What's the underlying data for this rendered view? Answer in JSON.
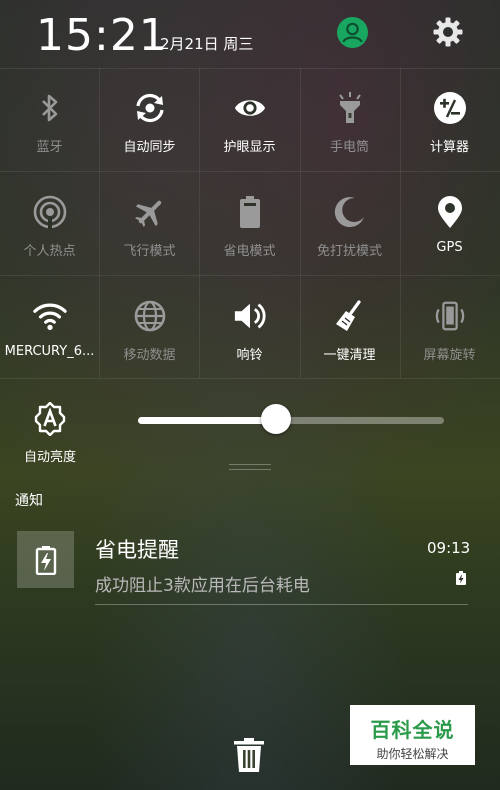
{
  "status": {
    "time": "15:21",
    "date": "2月21日 周三"
  },
  "tiles": [
    {
      "label": "蓝牙",
      "icon": "bluetooth-icon",
      "active": false
    },
    {
      "label": "自动同步",
      "icon": "sync-icon",
      "active": true
    },
    {
      "label": "护眼显示",
      "icon": "eye-icon",
      "active": true
    },
    {
      "label": "手电筒",
      "icon": "flashlight-icon",
      "active": false
    },
    {
      "label": "计算器",
      "icon": "calculator-icon",
      "active": true
    },
    {
      "label": "个人热点",
      "icon": "hotspot-icon",
      "active": false
    },
    {
      "label": "飞行模式",
      "icon": "airplane-icon",
      "active": false
    },
    {
      "label": "省电模式",
      "icon": "battery-icon",
      "active": false
    },
    {
      "label": "免打扰模式",
      "icon": "moon-icon",
      "active": false
    },
    {
      "label": "GPS",
      "icon": "location-icon",
      "active": true
    },
    {
      "label": "MERCURY_6...",
      "icon": "wifi-icon",
      "active": true
    },
    {
      "label": "移动数据",
      "icon": "globe-icon",
      "active": false
    },
    {
      "label": "响铃",
      "icon": "speaker-icon",
      "active": true
    },
    {
      "label": "一键清理",
      "icon": "broom-icon",
      "active": true
    },
    {
      "label": "屏幕旋转",
      "icon": "rotate-icon",
      "active": false
    }
  ],
  "brightness": {
    "auto_label": "自动亮度",
    "level": 0.45
  },
  "notifications": {
    "section_label": "通知",
    "items": [
      {
        "title": "省电提醒",
        "body": "成功阻止3款应用在后台耗电",
        "time": "09:13"
      }
    ]
  },
  "watermark": {
    "title": "百科全说",
    "subtitle": "助你轻松解决"
  },
  "colors": {
    "tile_on": "#ffffff",
    "tile_off": "#8f8f8f",
    "avatar": "#19a660",
    "brand_green": "#2b9b4b"
  }
}
